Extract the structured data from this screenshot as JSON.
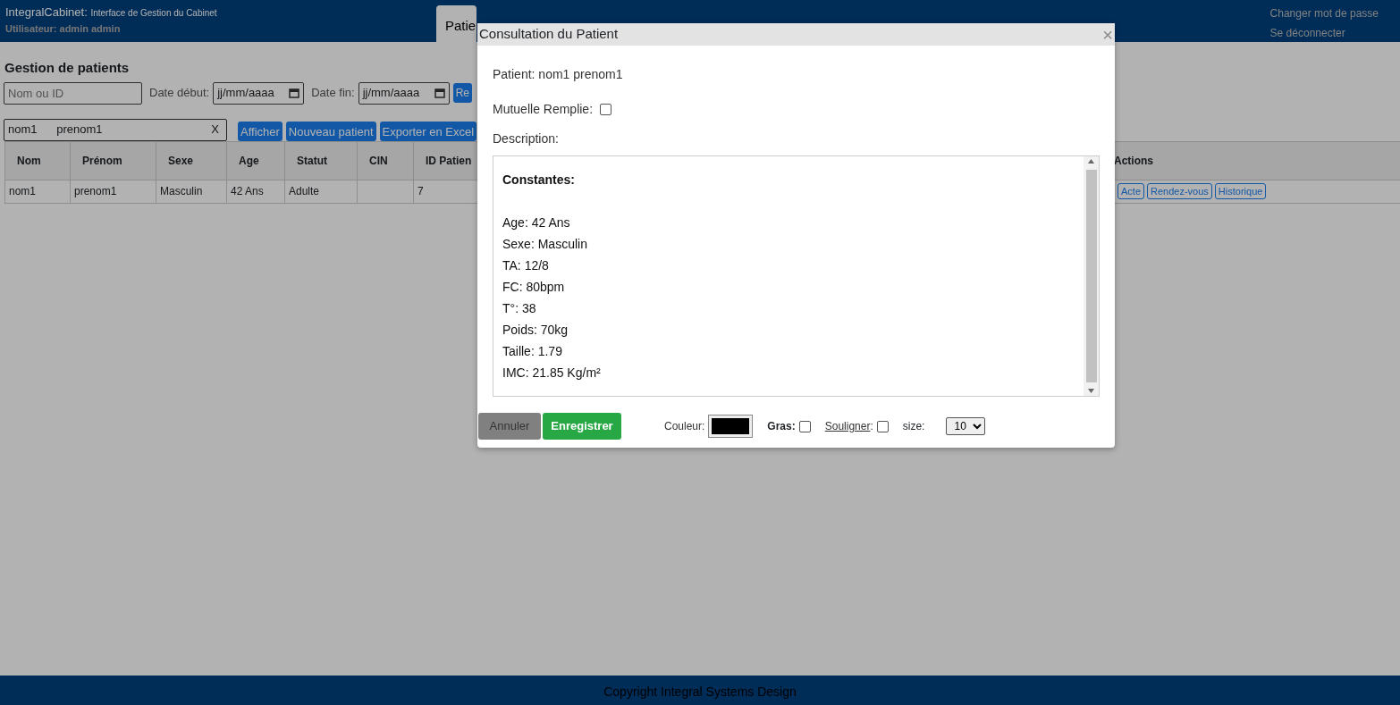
{
  "header": {
    "app_name": "IntegralCabinet:",
    "subtitle": "Interface de Gestion du Cabinet",
    "user": "Utilisateur: admin admin",
    "links": [
      "Changer mot de passe",
      "Se déconnecter"
    ]
  },
  "tabs": [
    {
      "label": "Patie",
      "selected": true
    }
  ],
  "page": {
    "title": "Gestion de patients",
    "filters": {
      "search_placeholder": "Nom ou ID",
      "start_label": "Date début:",
      "start_placeholder": "jj/mm/aaaa",
      "end_label": "Date fin:",
      "end_placeholder": "jj/mm/aaaa",
      "button": "Re"
    },
    "selection": {
      "value": "nom1      prenom1",
      "clear": "X"
    },
    "buttons": [
      "Afficher",
      "Nouveau patient",
      "Exporter en Excel"
    ],
    "table": {
      "columns": [
        "Nom",
        "Prénom",
        "Sexe",
        "Age",
        "Statut",
        "CIN",
        "ID Patien",
        "Actions"
      ],
      "rows": [
        {
          "cells": [
            "nom1",
            "prenom1",
            "Masculin",
            "42 Ans",
            "Adulte",
            "",
            "7"
          ],
          "actions": [
            "Acte",
            "Rendez-vous",
            "Historique"
          ]
        }
      ]
    }
  },
  "footer": {
    "text": "Copyright Integral Systems Design"
  },
  "modal": {
    "title": "Consultation du Patient",
    "close": "×",
    "patient": "Patient: nom1 prenom1",
    "mutuelle_label": "Mutuelle Remplie:",
    "mutuelle_checked": false,
    "description_label": "Description:",
    "editor": {
      "heading": "Constantes:",
      "lines": [
        "Age: 42 Ans",
        "Sexe: Masculin",
        "TA: 12/8",
        "FC: 80bpm",
        "T°: 38",
        "Poids: 70kg",
        "Taille: 1.79",
        "IMC: 21.85 Kg/m²"
      ]
    },
    "buttons": [
      {
        "label": "Annuler",
        "kind": "cancel"
      },
      {
        "label": "Enregistrer",
        "kind": "save"
      }
    ],
    "toolbar": {
      "color_label": "Couleur:",
      "bold_label": "Gras:",
      "bold_checked": false,
      "underline_label": "Souligner",
      "underline_suffix": ":",
      "underline_checked": false,
      "size_label": "size:",
      "size_value": "10"
    }
  }
}
